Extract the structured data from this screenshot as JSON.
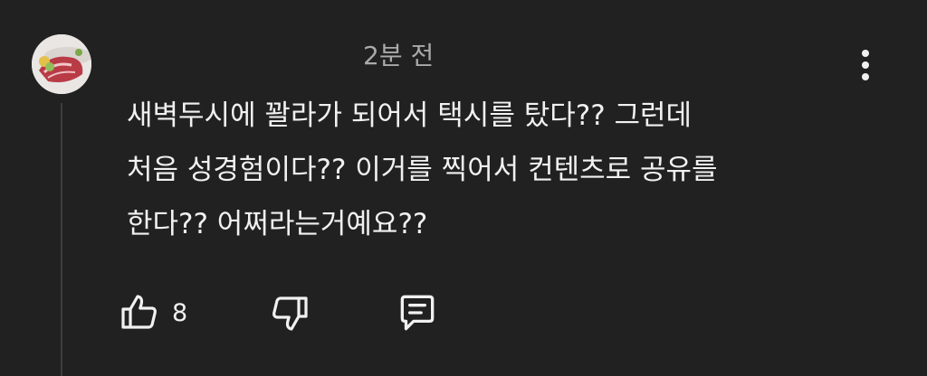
{
  "comment": {
    "timestamp": "2분 전",
    "text_lines": [
      "새벽두시에 꽐라가 되어서 택시를 탔다?? 그런데",
      "처음 성경험이다?? 이거를 찍어서 컨텐츠로 공유를",
      "한다?? 어쩌라는거예요??"
    ],
    "like_count": "8"
  },
  "icons": {
    "avatar": "avatar",
    "menu": "more-vert-icon",
    "like": "thumb-up-icon",
    "dislike": "thumb-down-icon",
    "reply": "reply-comment-icon"
  },
  "colors": {
    "background": "#212121",
    "text_primary": "#f1f1f1",
    "text_secondary": "#aaaaaa"
  }
}
